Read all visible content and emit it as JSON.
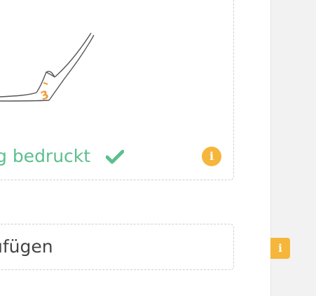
{
  "option_card": {
    "label": "g bedruckt",
    "check_icon": "check-icon",
    "info_icon": "info-icon",
    "info_glyph": "i",
    "illustration_page_number": "3"
  },
  "add_row": {
    "label": "ufügen"
  },
  "side_panel": {
    "info_icon": "info-icon",
    "info_glyph": "i"
  },
  "colors": {
    "accent_green": "#5bbf8e",
    "info_orange": "#f5b63b",
    "dashed_border": "#cfcfcf",
    "side_panel_bg": "#f2f2f2"
  }
}
